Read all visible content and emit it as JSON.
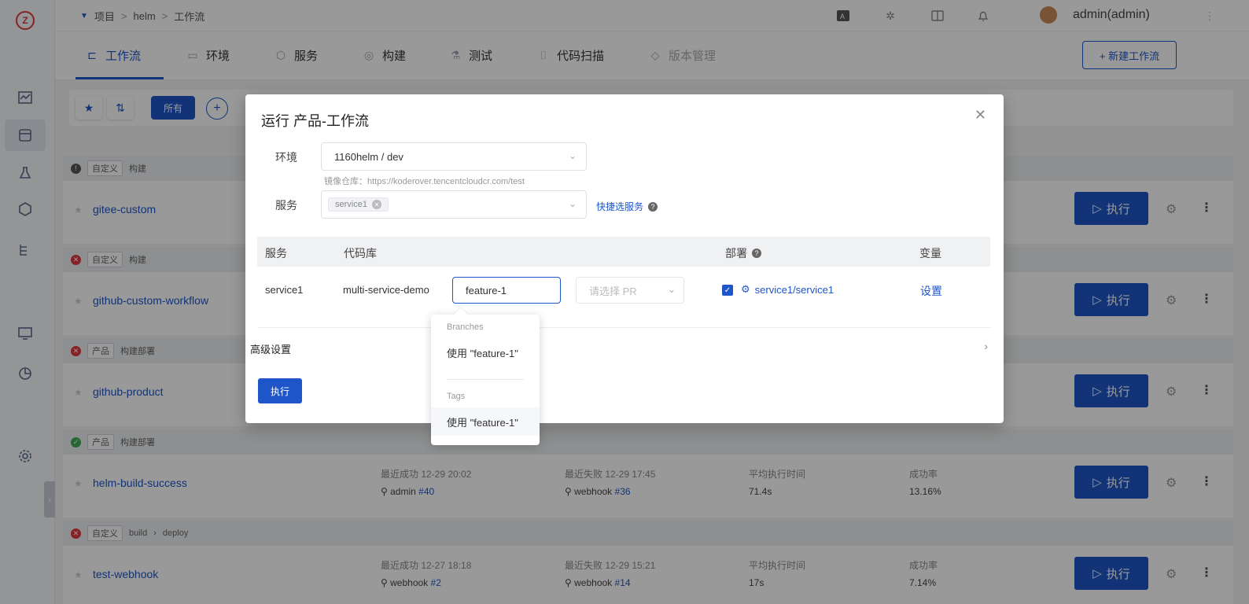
{
  "breadcrumb": {
    "items": [
      "项目",
      "helm",
      "工作流"
    ]
  },
  "user": {
    "name": "admin(admin)"
  },
  "tabs": [
    {
      "label": "工作流",
      "icon": "workflow-icon"
    },
    {
      "label": "环境",
      "icon": "environment-icon"
    },
    {
      "label": "服务",
      "icon": "service-icon"
    },
    {
      "label": "构建",
      "icon": "build-icon"
    },
    {
      "label": "测试",
      "icon": "test-icon"
    },
    {
      "label": "代码扫描",
      "icon": "code-scan-icon"
    },
    {
      "label": "版本管理",
      "icon": "version-icon"
    }
  ],
  "new_workflow_button": "+ 新建工作流",
  "filter": {
    "all_label": "所有"
  },
  "workflows": [
    {
      "name": "gitee-custom",
      "status": "running",
      "tag": "自定义",
      "stages": [
        "构建"
      ],
      "run_label": "执行"
    },
    {
      "name": "github-custom-workflow",
      "status": "failed",
      "tag": "自定义",
      "stages": [
        "构建"
      ],
      "run_label": "执行"
    },
    {
      "name": "github-product",
      "status": "failed",
      "tag": "产品",
      "stages": [
        "构建部署"
      ],
      "run_label": "执行"
    },
    {
      "name": "helm-build-success",
      "status": "success",
      "tag": "产品",
      "stages": [
        "构建部署"
      ],
      "run_label": "执行",
      "last_success_label": "最近成功 12-29 20:02",
      "last_success_user": "admin",
      "last_success_run": "#40",
      "last_fail_label": "最近失败 12-29 17:45",
      "last_fail_user": "webhook",
      "last_fail_run": "#36",
      "avg_time_label": "平均执行时间",
      "avg_time": "71.4s",
      "success_rate_label": "成功率",
      "success_rate": "13.16%"
    },
    {
      "name": "test-webhook",
      "status": "failed",
      "tag": "自定义",
      "stages": [
        "build",
        "deploy"
      ],
      "run_label": "执行",
      "last_success_label": "最近成功 12-27 18:18",
      "last_success_user": "webhook",
      "last_success_run": "#2",
      "last_fail_label": "最近失败 12-29 15:21",
      "last_fail_user": "webhook",
      "last_fail_run": "#14",
      "avg_time_label": "平均执行时间",
      "avg_time": "17s",
      "success_rate_label": "成功率",
      "success_rate": "7.14%"
    }
  ],
  "modal": {
    "title": "运行 产品-工作流",
    "env_label": "环境",
    "env_value": "1160helm / dev",
    "registry_hint": "镜像仓库：https://koderover.tencentcloudcr.com/test",
    "service_label": "服务",
    "service_chip": "service1",
    "quick_select": "快捷选服务",
    "table": {
      "headers": {
        "service": "服务",
        "repo": "代码库",
        "deploy": "部署",
        "vars": "变量"
      },
      "row": {
        "service": "service1",
        "repo": "multi-service-demo",
        "branch": "feature-1",
        "pr_placeholder": "请选择 PR",
        "deploy_target": "service1/service1",
        "vars_link": "设置"
      }
    },
    "advanced": "高级设置",
    "run_button": "执行"
  },
  "branch_dropdown": {
    "branches_label": "Branches",
    "branch_item": "使用 \"feature-1\"",
    "tags_label": "Tags",
    "tag_item": "使用 \"feature-1\""
  },
  "colors": {
    "primary": "#1e56c9",
    "danger": "#e0393e",
    "success": "#3fae52"
  }
}
